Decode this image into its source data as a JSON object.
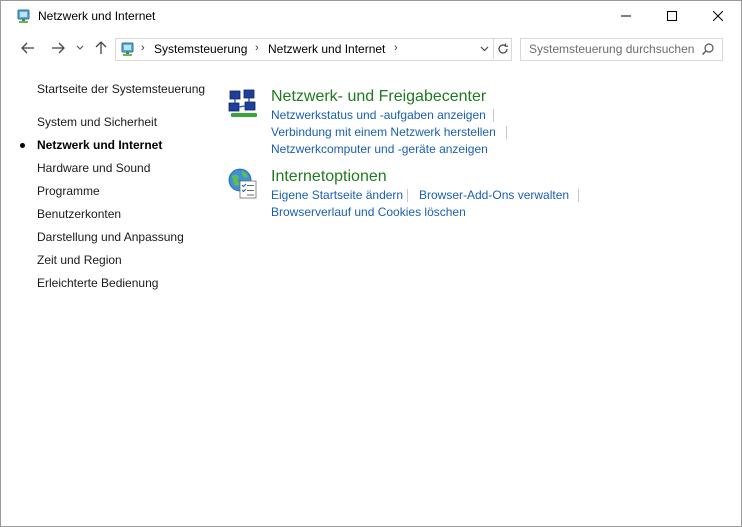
{
  "window": {
    "title": "Netzwerk und Internet",
    "minimize_label": "",
    "maximize_label": "",
    "close_label": ""
  },
  "nav": {
    "breadcrumb": [
      "Systemsteuerung",
      "Netzwerk und Internet"
    ],
    "search_placeholder": "Systemsteuerung durchsuchen"
  },
  "sidebar": {
    "home": "Startseite der Systemsteuerung",
    "items": [
      {
        "label": "System und Sicherheit",
        "active": false
      },
      {
        "label": "Netzwerk und Internet",
        "active": true
      },
      {
        "label": "Hardware und Sound",
        "active": false
      },
      {
        "label": "Programme",
        "active": false
      },
      {
        "label": "Benutzerkonten",
        "active": false
      },
      {
        "label": "Darstellung und Anpassung",
        "active": false
      },
      {
        "label": "Zeit und Region",
        "active": false
      },
      {
        "label": "Erleichterte Bedienung",
        "active": false
      }
    ]
  },
  "sections": [
    {
      "title": "Netzwerk- und Freigabecenter",
      "icon": "network-sharing-center-icon",
      "links": [
        "Netzwerkstatus und -aufgaben anzeigen",
        "Verbindung mit einem Netzwerk herstellen",
        "Netzwerkcomputer und -geräte anzeigen"
      ]
    },
    {
      "title": "Internetoptionen",
      "icon": "internet-options-icon",
      "links": [
        "Eigene Startseite ändern",
        "Browser-Add-Ons verwalten",
        "Browserverlauf und Cookies löschen"
      ]
    }
  ],
  "colors": {
    "section_title": "#1e7a1e",
    "link": "#1a5fb4"
  }
}
